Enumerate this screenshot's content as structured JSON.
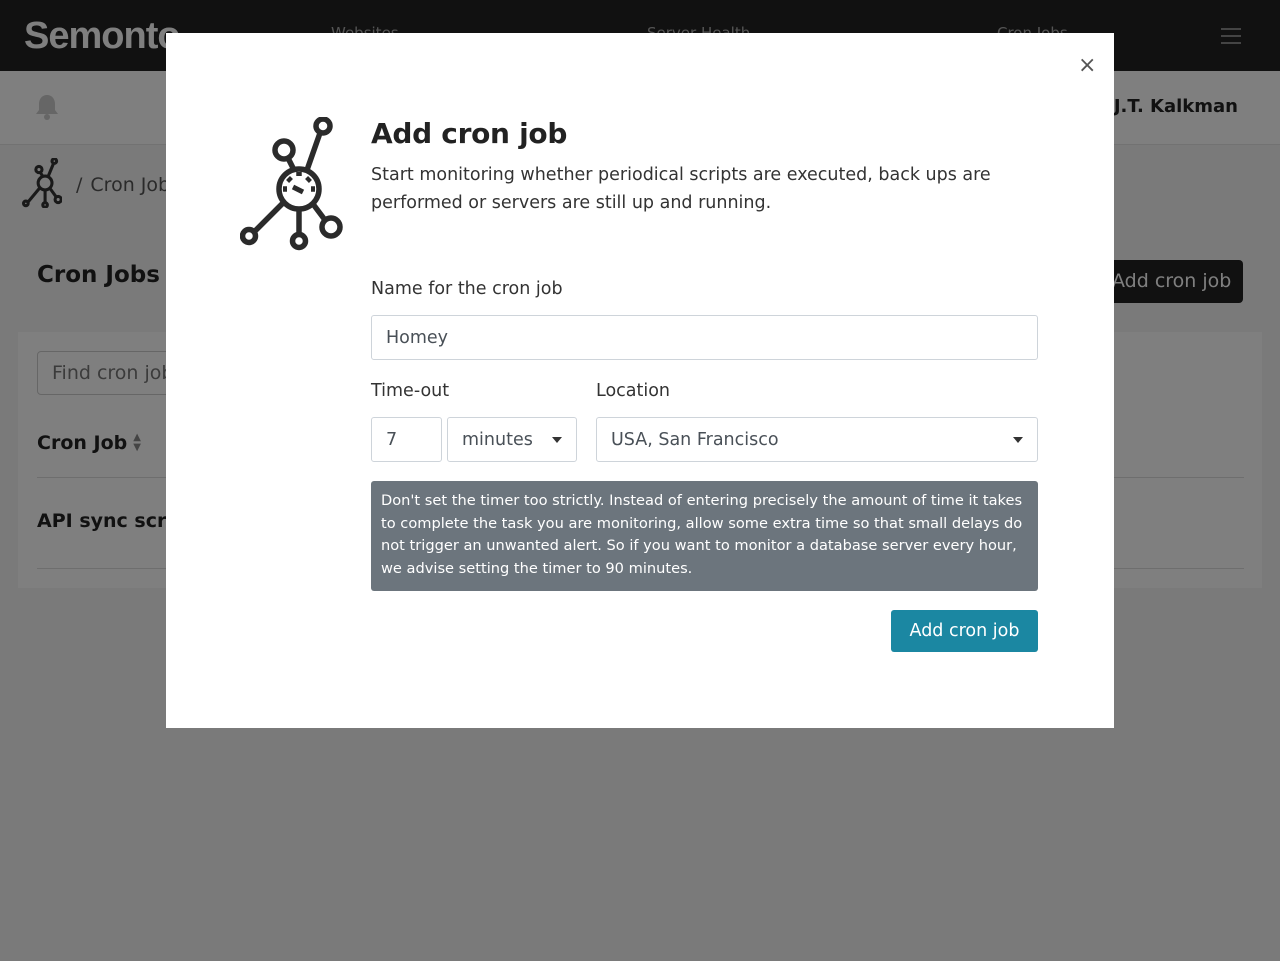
{
  "app": {
    "brand": "Semonto",
    "nav": [
      {
        "label": "Websites"
      },
      {
        "label": "Server Health"
      },
      {
        "label": "Cron Jobs"
      }
    ],
    "user_name": "J.T. Kalkman"
  },
  "page": {
    "breadcrumb_separator": "/",
    "breadcrumb_current": "Cron Jobs",
    "title": "Cron Jobs",
    "add_button_label": "Add cron job",
    "search_placeholder": "Find cron jobs",
    "table": {
      "columns": [
        {
          "label": "Cron Job",
          "sortable": true
        }
      ],
      "rows": [
        {
          "name": "API sync script"
        }
      ]
    }
  },
  "modal": {
    "close_label": "×",
    "title": "Add cron job",
    "description": "Start monitoring whether periodical scripts are executed, back ups are performed or servers are still up and running.",
    "name_label": "Name for the cron job",
    "name_value": "Homey",
    "timeout_label": "Time-out",
    "timeout_value": "7",
    "timeout_unit": "minutes",
    "location_label": "Location",
    "location_value": "USA, San Francisco",
    "hint": "Don't set the timer too strictly. Instead of entering precisely the amount of time it takes to complete the task you are monitoring, allow some extra time so that small delays do not trigger an unwanted alert. So if you want to monitor a database server every hour, we advise setting the timer to 90 minutes.",
    "submit_label": "Add cron job"
  },
  "colors": {
    "primary": "#1b87a2",
    "hint_bg": "#6c757d",
    "nav_bg": "#222222"
  }
}
